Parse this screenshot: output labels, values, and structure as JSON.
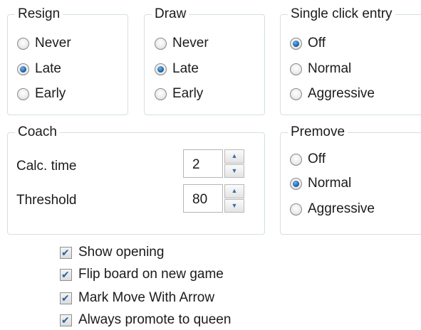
{
  "resign": {
    "title": "Resign",
    "options": [
      {
        "label": "Never",
        "checked": false
      },
      {
        "label": "Late",
        "checked": true
      },
      {
        "label": "Early",
        "checked": false
      }
    ]
  },
  "draw": {
    "title": "Draw",
    "options": [
      {
        "label": "Never",
        "checked": false
      },
      {
        "label": "Late",
        "checked": true
      },
      {
        "label": "Early",
        "checked": false
      }
    ]
  },
  "single_click_entry": {
    "title": "Single click entry",
    "options": [
      {
        "label": "Off",
        "checked": true
      },
      {
        "label": "Normal",
        "checked": false
      },
      {
        "label": "Aggressive",
        "checked": false
      }
    ]
  },
  "coach": {
    "title": "Coach",
    "calc_time": {
      "label": "Calc. time",
      "value": "2"
    },
    "threshold": {
      "label": "Threshold",
      "value": "80"
    }
  },
  "premove": {
    "title": "Premove",
    "options": [
      {
        "label": "Off",
        "checked": false
      },
      {
        "label": "Normal",
        "checked": true
      },
      {
        "label": "Aggressive",
        "checked": false
      }
    ]
  },
  "checkboxes": [
    {
      "label": "Show opening",
      "checked": true
    },
    {
      "label": "Flip board on new game",
      "checked": true
    },
    {
      "label": "Mark Move With Arrow",
      "checked": true
    },
    {
      "label": "Always promote to queen",
      "checked": true
    }
  ],
  "icons": {
    "spin_up": "up-arrow-icon",
    "spin_down": "down-arrow-icon",
    "check": "checkmark-icon"
  },
  "colors": {
    "accent": "#1d62a8",
    "group_border": "#d5dfe5"
  }
}
